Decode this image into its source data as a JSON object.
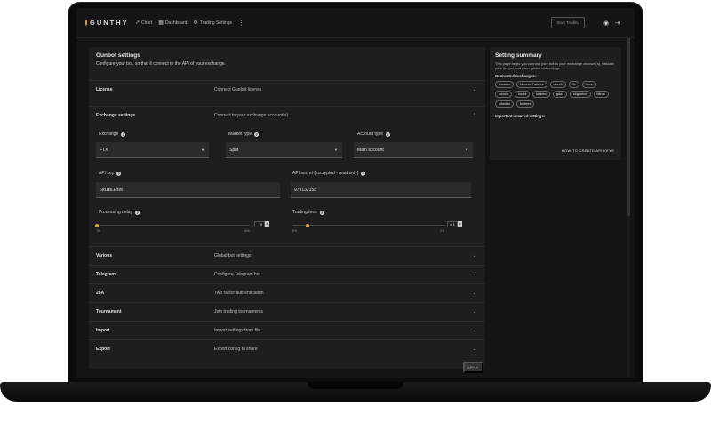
{
  "topbar": {
    "logo": "GUNTHY",
    "nav": [
      {
        "icon": "chart-line-icon",
        "glyph": "↗",
        "label": "Chart"
      },
      {
        "icon": "dashboard-icon",
        "glyph": "▦",
        "label": "Dashboard"
      },
      {
        "icon": "gear-icon",
        "glyph": "⚙",
        "label": "Trading Settings"
      }
    ],
    "start_button": "Start Trading"
  },
  "main": {
    "title": "Gunbot settings",
    "subtitle": "Configure your bot, so that it connect to the API of your exchange.",
    "license": {
      "label": "License",
      "desc": "Connect Gunbot license"
    },
    "exchange_settings": {
      "label": "Exchange settings",
      "desc": "Connect to your exchange account(s)"
    },
    "exchange": {
      "label": "Exchange",
      "value": "FTX"
    },
    "market_type": {
      "label": "Market type",
      "value": "Spot"
    },
    "account_type": {
      "label": "Account type",
      "value": "Main account"
    },
    "api_key": {
      "label": "API key",
      "value": "5Id1BLEsW"
    },
    "api_secret": {
      "label": "API secret [encrypted - read only]",
      "value": "97913215c"
    },
    "processing_delay": {
      "label": "Processing delay",
      "value": "0",
      "min": "0s",
      "max": "60s",
      "level": 0
    },
    "trading_fees": {
      "label": "Trading fees",
      "value": "0.1",
      "min": "0%",
      "max": "1%",
      "level": 0.1
    },
    "rows": [
      {
        "label": "Various",
        "desc": "Global bot settings"
      },
      {
        "label": "Telegram",
        "desc": "Configure Telegram bot"
      },
      {
        "label": "2FA",
        "desc": "Two factor authentication"
      },
      {
        "label": "Tournament",
        "desc": "Join trading tournaments"
      },
      {
        "label": "Import",
        "desc": "Import settings from file"
      },
      {
        "label": "Export",
        "desc": "Export config to share"
      }
    ],
    "apply_button": "APPLY"
  },
  "summary": {
    "title": "Setting summary",
    "text": "This page helps you connect your bot to your exchange account(s), validate your license and more global bot settings.",
    "connected_label": "Connected exchanges:",
    "exchanges": [
      "binance",
      "binanceFutures",
      "okex5",
      "ftx",
      "ftxus",
      "kucoin",
      "huobi",
      "kraken",
      "gdax",
      "okgunbot",
      "bitrue",
      "bitmexx",
      "bitfinex"
    ],
    "unsaved_label": "Important unsaved settings:",
    "howto": "HOW TO CREATE API KEYS"
  }
}
